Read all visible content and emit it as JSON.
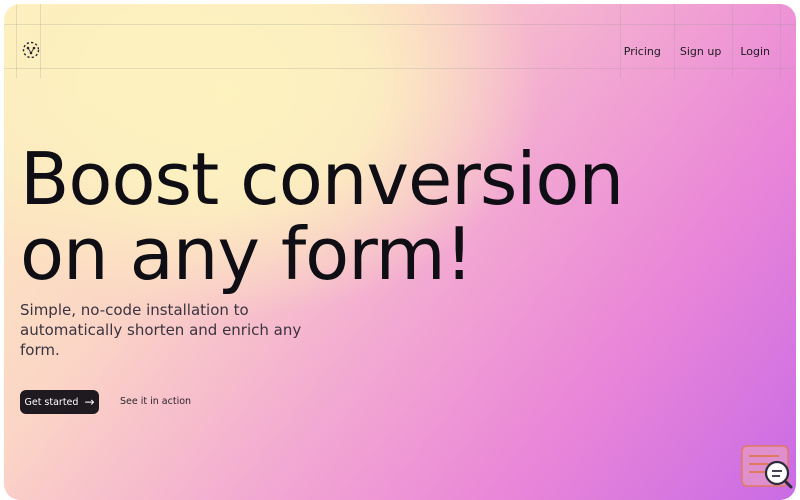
{
  "nav": {
    "logo_icon": "network-logo-icon",
    "items": [
      {
        "label": "Pricing"
      },
      {
        "label": "Sign up"
      },
      {
        "label": "Login"
      }
    ]
  },
  "hero": {
    "title_line1": "Boost conversion",
    "title_line2": "on any form!",
    "subtitle": "Simple, no-code installation to automatically shorten and enrich any form.",
    "primary_cta": {
      "label": "Get started",
      "icon": "arrow-right-icon"
    },
    "secondary_cta": {
      "label": "See it in action"
    }
  },
  "widget": {
    "icon": "form-search-icon"
  },
  "colors": {
    "gradient_start": "#fdefbd",
    "gradient_mid": "#f2a7d2",
    "gradient_end": "#c96be5",
    "text_dark": "#0e0e14",
    "button_bg": "#1e1a1f"
  }
}
